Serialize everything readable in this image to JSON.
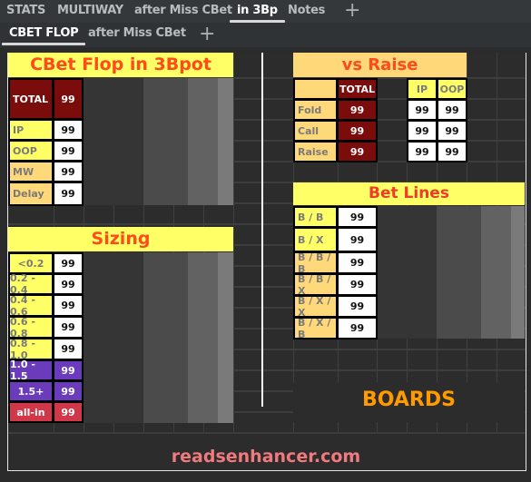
{
  "tabs_primary": [
    {
      "label": "STATS",
      "active": false
    },
    {
      "label": "MULTIWAY",
      "active": false
    },
    {
      "label": "after Miss CBet",
      "active": false
    },
    {
      "label": "in 3Bp",
      "active": true
    },
    {
      "label": "Notes",
      "active": false
    }
  ],
  "tabs_secondary": [
    {
      "label": "CBET FLOP",
      "active": true
    },
    {
      "label": "after Miss CBet",
      "active": false
    }
  ],
  "add_tab_icon": "+",
  "cbet_flop": {
    "title": "CBet Flop in 3Bpot",
    "total_label": "TOTAL",
    "total_value": "99",
    "rows": [
      {
        "label": "IP",
        "value": "99"
      },
      {
        "label": "OOP",
        "value": "99"
      },
      {
        "label": "MW",
        "value": "99"
      },
      {
        "label": "Delay",
        "value": "99"
      }
    ]
  },
  "sizing": {
    "title": "Sizing",
    "rows": [
      {
        "label": "<0.2",
        "value": "99"
      },
      {
        "label": "0.2 - 0.4",
        "value": "99"
      },
      {
        "label": "0.4 - 0.6",
        "value": "99"
      },
      {
        "label": "0.6 - 0.8",
        "value": "99"
      },
      {
        "label": "0.8 - 1.0",
        "value": "99"
      },
      {
        "label": "1.0 - 1.5",
        "value": "99"
      },
      {
        "label": "1.5+",
        "value": "99"
      },
      {
        "label": "all-in",
        "value": "99"
      }
    ]
  },
  "vs_raise": {
    "title": "vs Raise",
    "col_total": "TOTAL",
    "col_ip": "IP",
    "col_oop": "OOP",
    "rows": [
      {
        "label": "Fold",
        "total": "99",
        "ip": "99",
        "oop": "99"
      },
      {
        "label": "Call",
        "total": "99",
        "ip": "99",
        "oop": "99"
      },
      {
        "label": "Raise",
        "total": "99",
        "ip": "99",
        "oop": "99"
      }
    ]
  },
  "bet_lines": {
    "title": "Bet Lines",
    "rows": [
      {
        "label": "B / B",
        "value": "99"
      },
      {
        "label": "B / X",
        "value": "99"
      },
      {
        "label": "B / B / B",
        "value": "99"
      },
      {
        "label": "B / B / X",
        "value": "99"
      },
      {
        "label": "B / X / X",
        "value": "99"
      },
      {
        "label": "B / X / B",
        "value": "99"
      }
    ]
  },
  "boards_label": "BOARDS",
  "footer": "readsenhancer.com"
}
